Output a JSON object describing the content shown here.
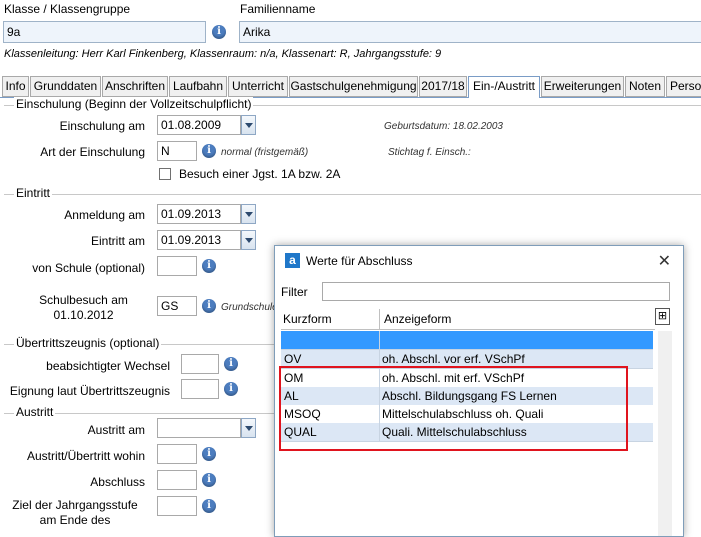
{
  "header": {
    "klasse_label": "Klasse / Klassengruppe",
    "klasse_value": "9a",
    "familienname_label": "Familienname",
    "familienname_value": "Arika",
    "info_line": "Klassenleitung: Herr Karl Finkenberg, Klassenraum: n/a, Klassenart: R, Jahrgangsstufe: 9"
  },
  "tabs": [
    {
      "label": "Info"
    },
    {
      "label": "Grunddaten"
    },
    {
      "label": "Anschriften"
    },
    {
      "label": "Laufbahn"
    },
    {
      "label": "Unterricht"
    },
    {
      "label": "Gastschulgenehmigung"
    },
    {
      "label": "2017/18"
    },
    {
      "label": "Ein-/Austritt",
      "active": true
    },
    {
      "label": "Erweiterungen"
    },
    {
      "label": "Noten"
    },
    {
      "label": "Perso"
    }
  ],
  "einschulung": {
    "section_title": "Einschulung (Beginn der Vollzeitschulpflicht)",
    "einschulung_am_label": "Einschulung am",
    "einschulung_am_value": "01.08.2009",
    "geburtsdatum": "Geburtsdatum: 18.02.2003",
    "art_label": "Art der Einschulung",
    "art_value": "N",
    "art_hint": "normal (fristgemäß)",
    "stichtag": "Stichtag f. Einsch.:",
    "checkbox_label": "Besuch einer Jgst. 1A bzw. 2A"
  },
  "eintritt": {
    "section_title": "Eintritt",
    "anmeldung_label": "Anmeldung am",
    "anmeldung_value": "01.09.2013",
    "eintritt_label": "Eintritt am",
    "eintritt_value": "01.09.2013",
    "von_schule_label": "von Schule (optional)",
    "schulbesuch_label_1": "Schulbesuch am",
    "schulbesuch_label_2": "01.10.2012",
    "schulbesuch_value": "GS",
    "schulbesuch_hint": "Grundschule"
  },
  "uebertritt": {
    "section_title": "Übertrittszeugnis (optional)",
    "wechsel_label": "beabsichtigter Wechsel",
    "eignung_label": "Eignung laut Übertrittszeugnis"
  },
  "austritt": {
    "section_title": "Austritt",
    "austritt_am_label": "Austritt am",
    "wohin_label": "Austritt/Übertritt wohin",
    "abschluss_label": "Abschluss",
    "ziel_label_1": "Ziel der Jahrgangsstufe",
    "ziel_label_2": "am Ende des"
  },
  "dialog": {
    "title": "Werte für Abschluss",
    "filter_label": "Filter",
    "filter_value": "",
    "col_kurzform": "Kurzform",
    "col_anzeigeform": "Anzeigeform",
    "rows": [
      {
        "kurz": "",
        "anzeige": ""
      },
      {
        "kurz": "OV",
        "anzeige": "oh. Abschl. vor erf. VSchPf"
      },
      {
        "kurz": "OM",
        "anzeige": "oh. Abschl. mit erf. VSchPf"
      },
      {
        "kurz": "AL",
        "anzeige": "Abschl. Bildungsgang FS Lernen"
      },
      {
        "kurz": "MSOQ",
        "anzeige": "Mittelschulabschluss oh. Quali"
      },
      {
        "kurz": "QUAL",
        "anzeige": "Quali. Mittelschulabschluss"
      }
    ]
  },
  "colors": {
    "selected_row": "#3399ff",
    "alt_row": "#dce7f5",
    "highlight_border": "#e0141e",
    "tab_active_border": "#7a9cc6"
  }
}
